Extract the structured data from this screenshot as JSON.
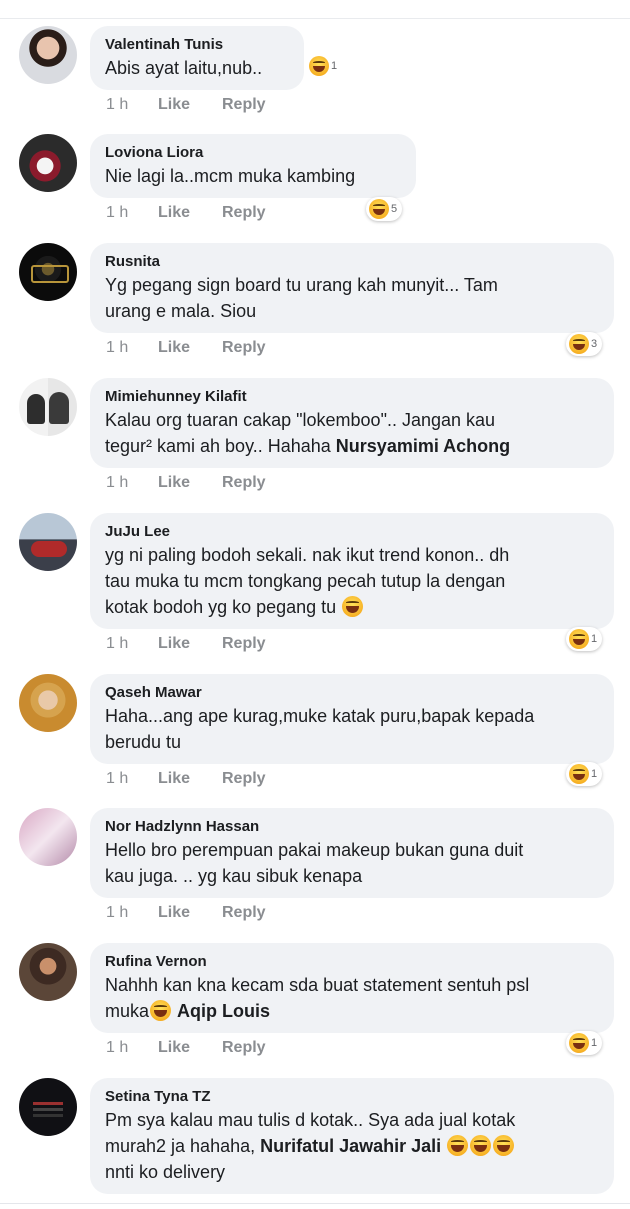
{
  "comments": [
    {
      "author": "Valentinah Tunis",
      "lines": [
        "Abis ayat laitu,nub.."
      ],
      "time": "1 h",
      "like": "Like",
      "reply": "Reply",
      "reaction_count": "1"
    },
    {
      "author": "Loviona Liora",
      "lines": [
        "Nie lagi la..mcm muka kambing"
      ],
      "time": "1 h",
      "like": "Like",
      "reply": "Reply",
      "reaction_count": "5"
    },
    {
      "author": "Rusnita",
      "lines": [
        "Yg pegang sign board tu urang kah munyit... Tam",
        "urang e mala. Siou"
      ],
      "time": "1 h",
      "like": "Like",
      "reply": "Reply",
      "reaction_count": "3"
    },
    {
      "author": "Mimiehunney Kilafit",
      "lines": [
        "Kalau org tuaran cakap \"lokemboo\".. Jangan kau",
        "tegur² kami ah boy.. Hahaha "
      ],
      "tag": "Nursyamimi Achong",
      "time": "1 h",
      "like": "Like",
      "reply": "Reply"
    },
    {
      "author": "JuJu Lee",
      "lines": [
        "yg ni paling bodoh sekali. nak ikut trend konon.. dh",
        "tau muka tu mcm tongkang pecah tutup la dengan",
        "kotak bodoh yg ko pegang tu "
      ],
      "time": "1 h",
      "like": "Like",
      "reply": "Reply",
      "reaction_count": "1"
    },
    {
      "author": "Qaseh Mawar",
      "lines": [
        "Haha...ang ape kurag,muke katak puru,bapak kepada",
        "berudu tu"
      ],
      "time": "1 h",
      "like": "Like",
      "reply": "Reply",
      "reaction_count": "1"
    },
    {
      "author": "Nor Hadzlynn Hassan",
      "lines": [
        "Hello bro perempuan pakai makeup bukan guna duit",
        "kau juga. .. yg kau sibuk kenapa"
      ],
      "time": "1 h",
      "like": "Like",
      "reply": "Reply"
    },
    {
      "author": "Rufina Vernon",
      "lines": [
        "Nahhh kan kna kecam sda buat statement sentuh psl",
        "muka"
      ],
      "tag": "Aqip Louis",
      "time": "1 h",
      "like": "Like",
      "reply": "Reply",
      "reaction_count": "1"
    },
    {
      "author": "Setina Tyna TZ",
      "lines": [
        "Pm sya kalau mau tulis d kotak.. Sya ada jual kotak",
        "murah2 ja hahaha, ",
        "nnti ko delivery"
      ],
      "tag": "Nurifatul Jawahir Jali"
    }
  ],
  "emoji": "grinning-squinting-tears-icon",
  "colors": {
    "bubble": "#f0f2f5",
    "meta": "#8a8d91",
    "text": "#1c1e21",
    "emoji": "#f7b125"
  }
}
